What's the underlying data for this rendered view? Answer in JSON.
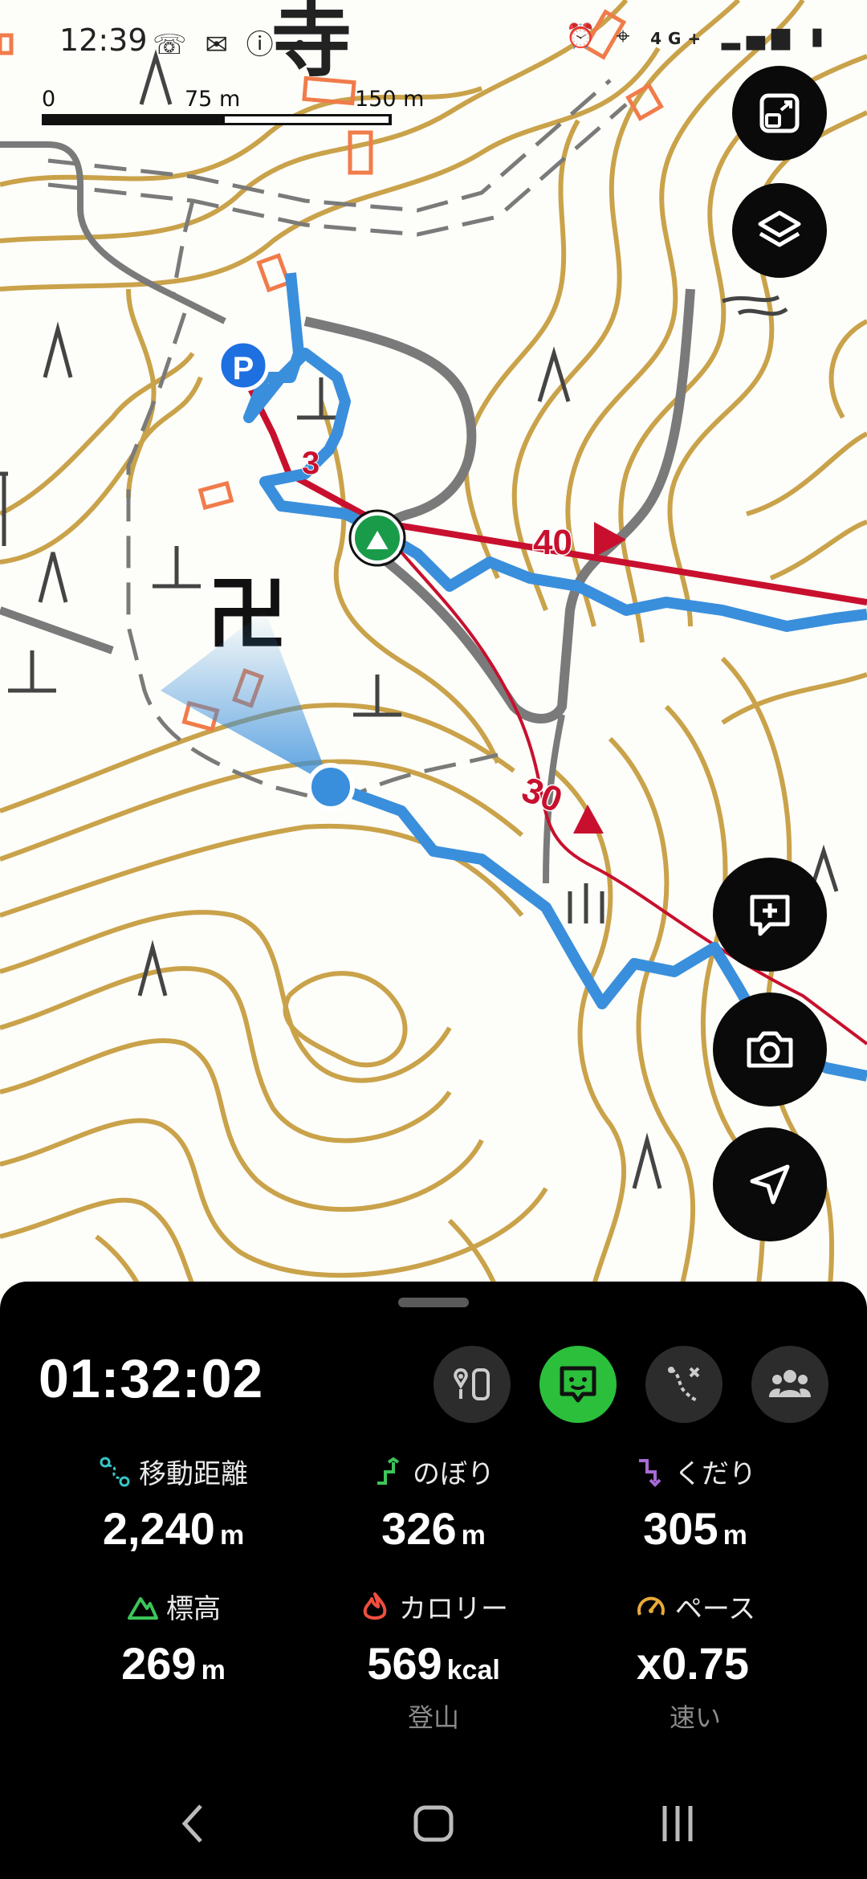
{
  "status_bar": {
    "time": "12:39",
    "network_label": "4G+",
    "icons": [
      "missed-call-icon",
      "mail-icon",
      "info-icon",
      "dot-icon",
      "alarm-icon",
      "location-icon",
      "signal-icon",
      "battery-icon"
    ]
  },
  "map": {
    "scale": {
      "label_0": "0",
      "label_75": "75 m",
      "label_150": "150 m"
    },
    "labels": {
      "temple": "寺",
      "temple_symbol": "卍",
      "parking": "P",
      "route_num": "3",
      "marker_40": "40",
      "marker_30": "30"
    },
    "colors": {
      "contour": "#c9a24a",
      "track": "#3a8fdc",
      "route": "#c8102e",
      "road": "#7a7a7a"
    },
    "buttons": [
      "expand-button",
      "layers-button",
      "add-memo-button",
      "camera-button",
      "navigate-button"
    ]
  },
  "tracker": {
    "elapsed": "01:32:02",
    "toolbar_icons": [
      "route-info-icon",
      "chat-icon",
      "path-icon",
      "group-icon"
    ],
    "stats": [
      {
        "label": "移動距離",
        "value": "2,240",
        "unit": "m",
        "icon": "distance-icon",
        "color": "#38c6c6"
      },
      {
        "label": "のぼり",
        "value": "326",
        "unit": "m",
        "icon": "ascent-icon",
        "color": "#3dc55a"
      },
      {
        "label": "くだり",
        "value": "305",
        "unit": "m",
        "icon": "descent-icon",
        "color": "#a86ad6"
      },
      {
        "label": "標高",
        "value": "269",
        "unit": "m",
        "icon": "elevation-icon",
        "color": "#3dc55a"
      },
      {
        "label": "カロリー",
        "value": "569",
        "unit": "kcal",
        "sub": "登山",
        "icon": "calorie-icon",
        "color": "#f04e3e"
      },
      {
        "label": "ペース",
        "value": "x0.75",
        "unit": "",
        "sub": "速い",
        "icon": "pace-icon",
        "color": "#e7a93a"
      }
    ]
  },
  "nav_bar": {
    "back": "back-icon",
    "home": "home-icon",
    "recents": "recents-icon"
  }
}
